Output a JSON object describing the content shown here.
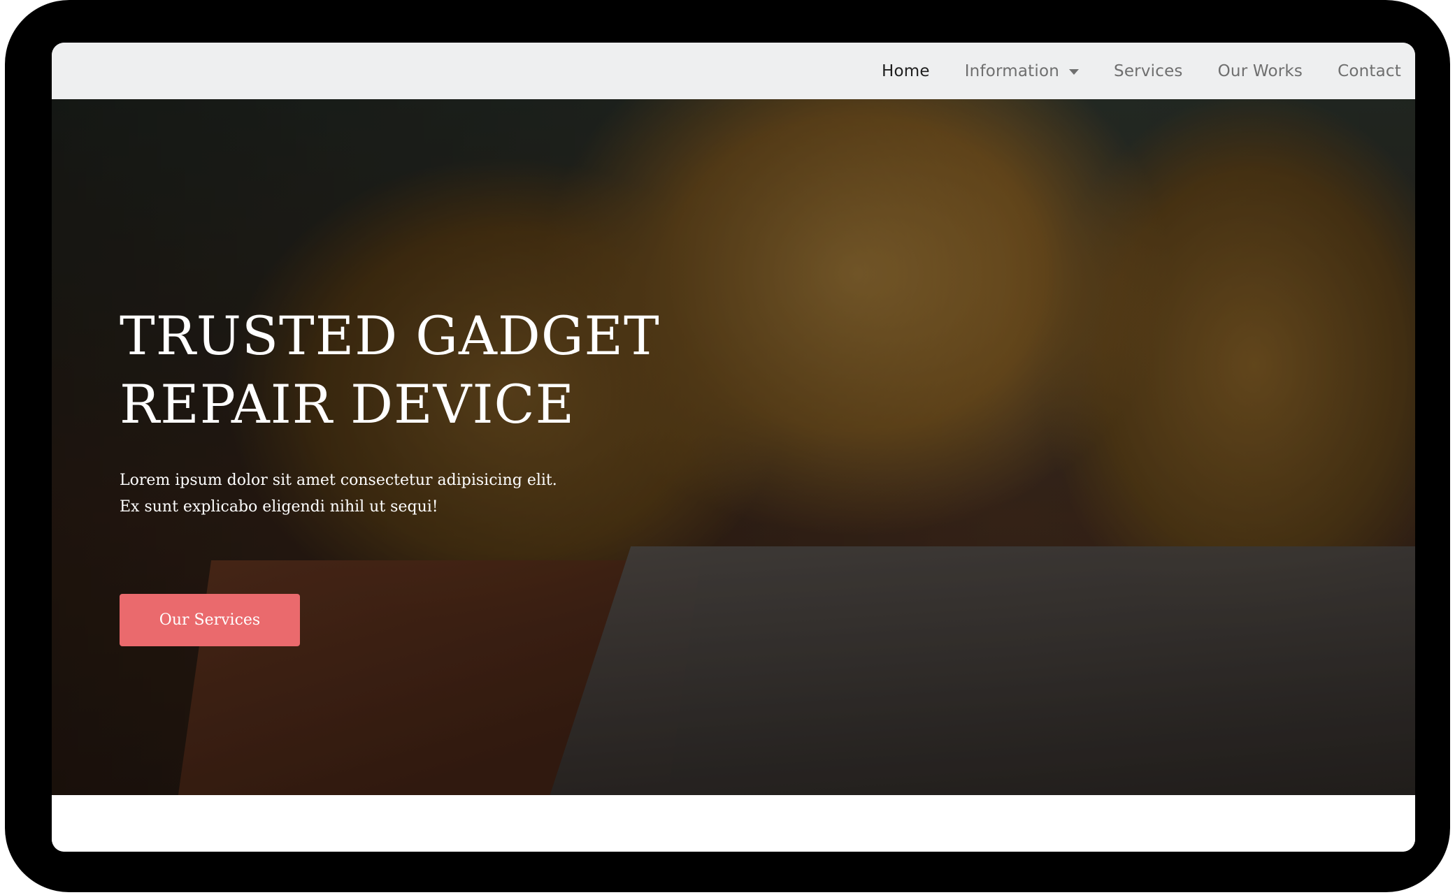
{
  "nav": {
    "items": [
      {
        "label": "Home",
        "active": true,
        "dropdown": false
      },
      {
        "label": "Information",
        "active": false,
        "dropdown": true
      },
      {
        "label": "Services",
        "active": false,
        "dropdown": false
      },
      {
        "label": "Our Works",
        "active": false,
        "dropdown": false
      },
      {
        "label": "Contact",
        "active": false,
        "dropdown": false
      }
    ]
  },
  "hero": {
    "title_line1": "TRUSTED GADGET",
    "title_line2": "REPAIR DEVICE",
    "description_line1": "Lorem ipsum dolor sit amet consectetur adipisicing elit.",
    "description_line2": "Ex sunt explicabo eligendi nihil ut sequi!",
    "cta_label": "Our Services",
    "background_image": "person-typing-on-laptop-photo"
  },
  "colors": {
    "navbar_bg": "#eeeff0",
    "cta_bg": "#ea6a6d",
    "device_frame": "#000000",
    "nav_active": "#1e1e1e",
    "nav_inactive": "#6f6f6f"
  }
}
